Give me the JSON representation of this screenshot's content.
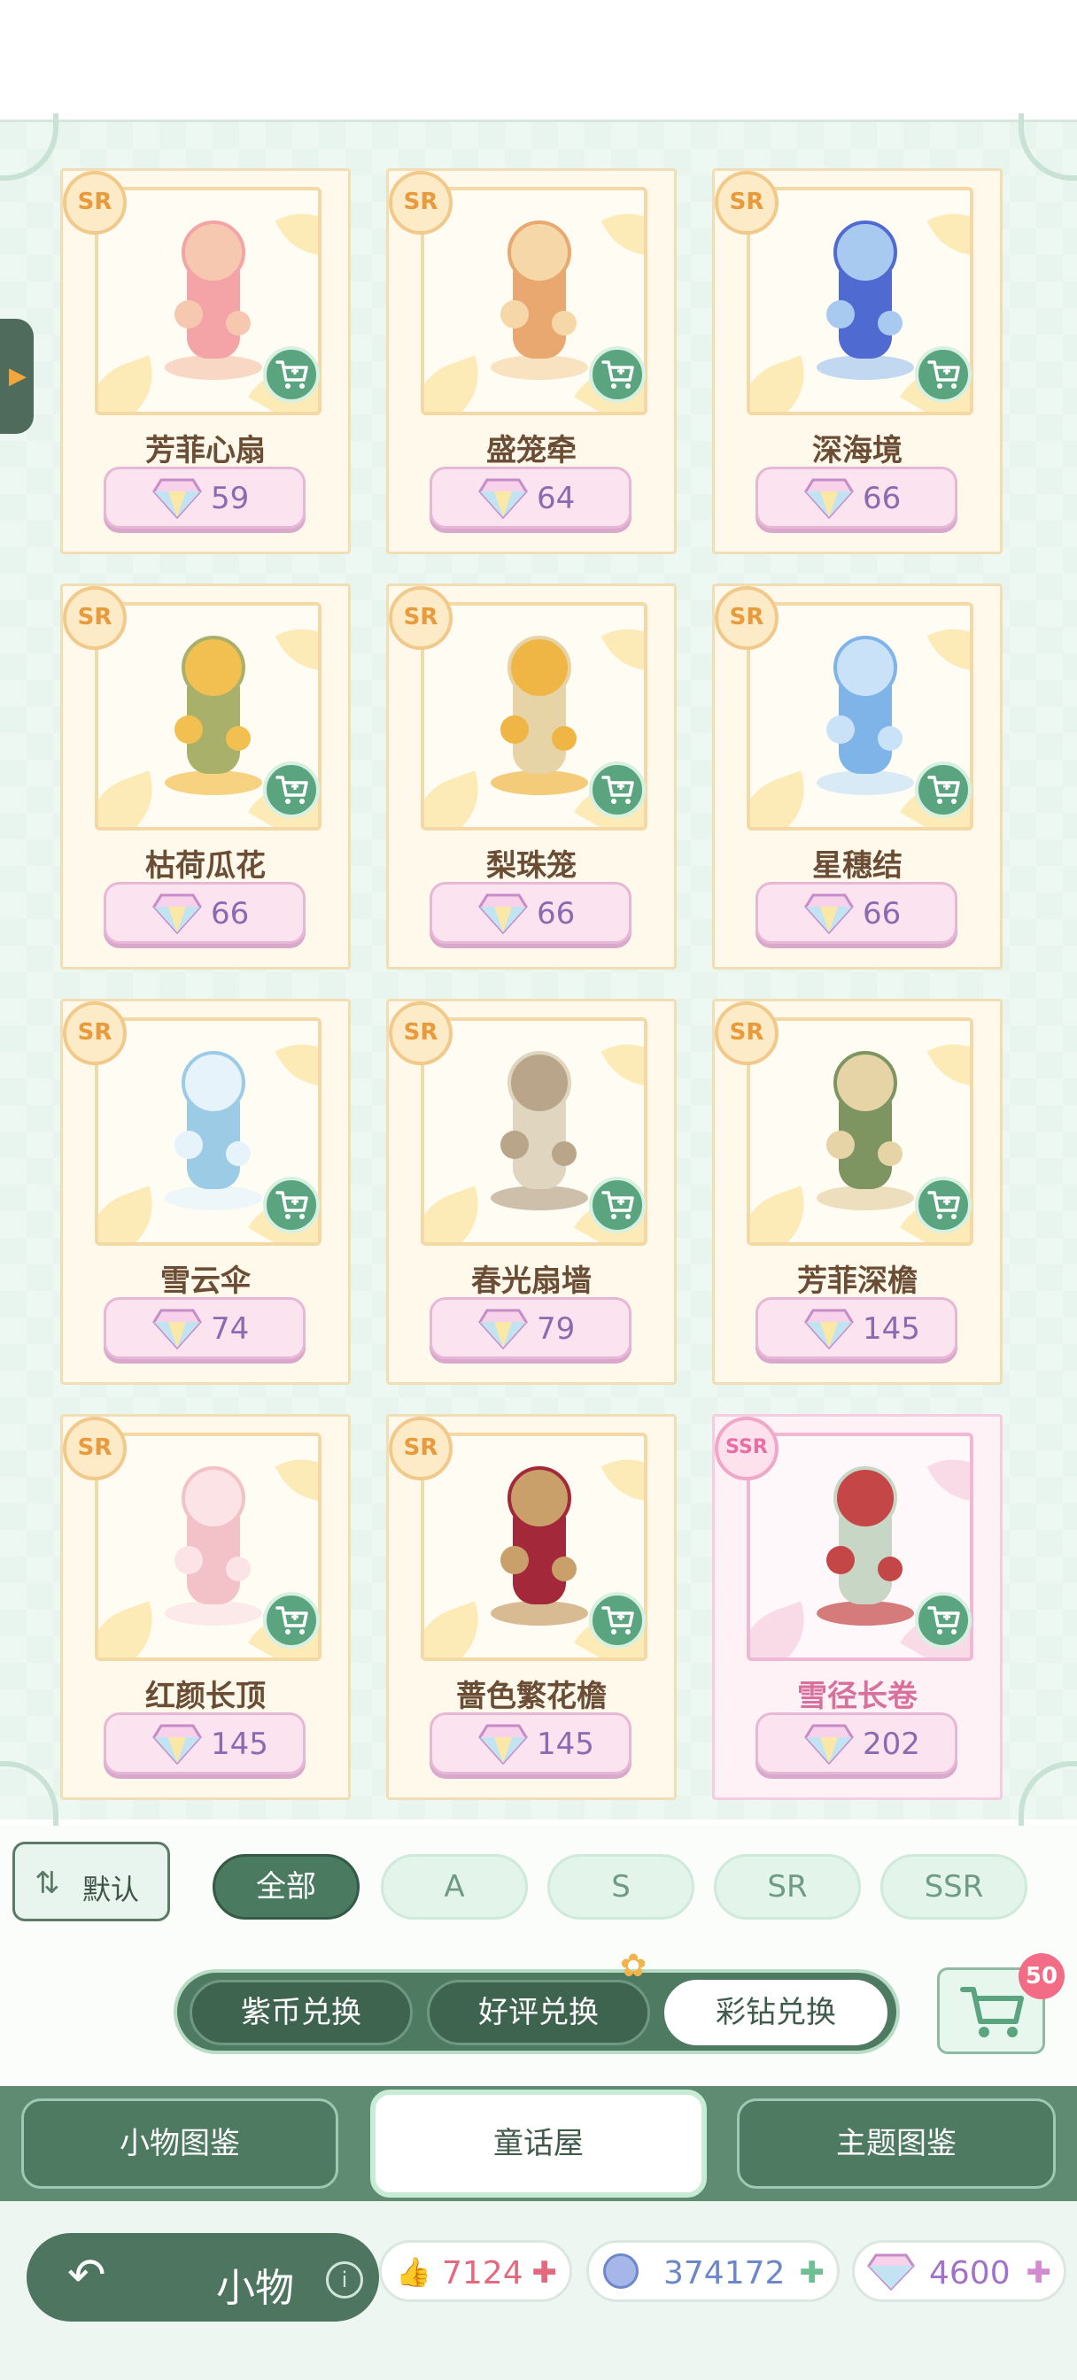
{
  "cards": [
    {
      "rarity": "SR",
      "name": "芳菲心扇",
      "price": "59"
    },
    {
      "rarity": "SR",
      "name": "盛笼牵",
      "price": "64"
    },
    {
      "rarity": "SR",
      "name": "深海境",
      "price": "66"
    },
    {
      "rarity": "SR",
      "name": "枯荷瓜花",
      "price": "66"
    },
    {
      "rarity": "SR",
      "name": "梨珠笼",
      "price": "66"
    },
    {
      "rarity": "SR",
      "name": "星穗结",
      "price": "66"
    },
    {
      "rarity": "SR",
      "name": "雪云伞",
      "price": "74"
    },
    {
      "rarity": "SR",
      "name": "春光扇墙",
      "price": "79"
    },
    {
      "rarity": "SR",
      "name": "芳菲深檐",
      "price": "145"
    },
    {
      "rarity": "SR",
      "name": "红颜长顶",
      "price": "145"
    },
    {
      "rarity": "SR",
      "name": "蔷色繁花檐",
      "price": "145"
    },
    {
      "rarity": "SSR",
      "name": "雪径长卷",
      "price": "202"
    }
  ],
  "filter": {
    "sort_label": "默认",
    "chips": [
      "全部",
      "A",
      "S",
      "SR",
      "SSR"
    ],
    "active_chip": "全部"
  },
  "exchange": {
    "tabs": [
      "紫币兑换",
      "好评兑换",
      "彩钻兑换"
    ],
    "active": "彩钻兑换",
    "cart_count": "50"
  },
  "main_tabs": {
    "tabs": [
      "小物图鉴",
      "童话屋",
      "主题图鉴"
    ],
    "active": "童话屋"
  },
  "bottom": {
    "title": "小物",
    "resources": [
      {
        "icon": "thumbs-up-icon",
        "value": "7124",
        "color": "#e2697e"
      },
      {
        "icon": "purple-coin-icon",
        "value": "374172",
        "color": "#6d88c8"
      },
      {
        "icon": "diamond-icon",
        "value": "4600",
        "color": "#a272c8"
      }
    ]
  },
  "colors": {
    "panel_bg": "#e8f5ef",
    "accent_green": "#4a7a5f",
    "sr_badge": "#e89a3c",
    "ssr_badge": "#e76fa4",
    "price_text": "#8a6bb0"
  }
}
